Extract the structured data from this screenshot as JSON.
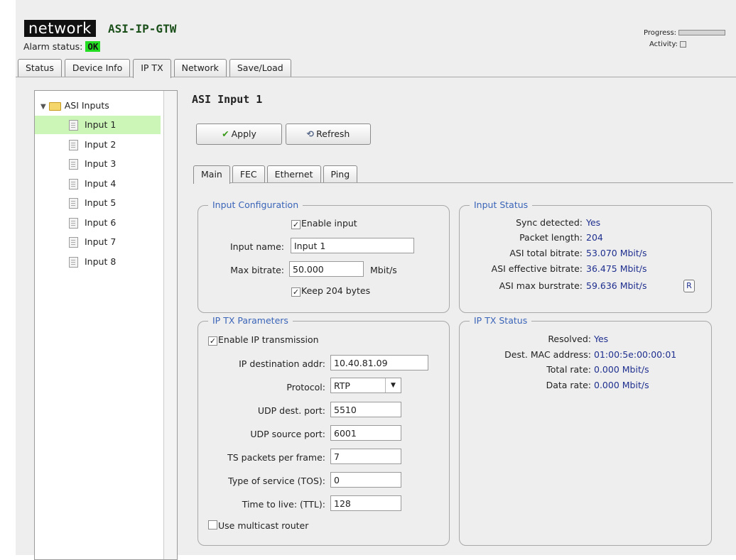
{
  "header": {
    "logo": "network",
    "device_name": "ASI-IP-GTW",
    "alarm_label": "Alarm status:",
    "alarm_value": "OK",
    "progress_label": "Progress:",
    "activity_label": "Activity:",
    "colors": {
      "ok": "#22dd22",
      "accent": "#3a64b8",
      "value": "#1f2f8f"
    }
  },
  "tabs": [
    {
      "label": "Status"
    },
    {
      "label": "Device Info"
    },
    {
      "label": "IP TX"
    },
    {
      "label": "Network"
    },
    {
      "label": "Save/Load"
    }
  ],
  "tree": {
    "root": "ASI Inputs",
    "items": [
      "Input 1",
      "Input 2",
      "Input 3",
      "Input 4",
      "Input 5",
      "Input 6",
      "Input 7",
      "Input 8"
    ]
  },
  "panel": {
    "title": "ASI Input 1",
    "apply_label": "Apply",
    "refresh_label": "Refresh",
    "subtabs": [
      "Main",
      "FEC",
      "Ethernet",
      "Ping"
    ]
  },
  "input_config": {
    "legend": "Input Configuration",
    "enable_input": "Enable input",
    "name_label": "Input name:",
    "name_value": "Input 1",
    "bitrate_label": "Max bitrate:",
    "bitrate_value": "50.000",
    "bitrate_unit": "Mbit/s",
    "keep204": "Keep 204 bytes"
  },
  "input_status": {
    "legend": "Input Status",
    "rows": [
      {
        "label": "Sync detected:",
        "value": "Yes"
      },
      {
        "label": "Packet length:",
        "value": "204"
      },
      {
        "label": "ASI total bitrate:",
        "value": "53.070 Mbit/s"
      },
      {
        "label": "ASI effective bitrate:",
        "value": "36.475 Mbit/s"
      },
      {
        "label": "ASI max burstrate:",
        "value": "59.636 Mbit/s"
      }
    ],
    "reset_label": "R"
  },
  "ip_tx_params": {
    "legend": "IP TX Parameters",
    "enable_ip": "Enable IP transmission",
    "dest_label": "IP destination addr:",
    "dest_value": "10.40.81.09",
    "protocol_label": "Protocol:",
    "protocol_value": "RTP",
    "udp_dest_label": "UDP dest. port:",
    "udp_dest_value": "5510",
    "udp_src_label": "UDP source port:",
    "udp_src_value": "6001",
    "ts_label": "TS packets per frame:",
    "ts_value": "7",
    "tos_label": "Type of service (TOS):",
    "tos_value": "0",
    "ttl_label": "Time to live: (TTL):",
    "ttl_value": "128",
    "multicast": "Use multicast router"
  },
  "ip_tx_status": {
    "legend": "IP TX Status",
    "rows": [
      {
        "label": "Resolved:",
        "value": "Yes"
      },
      {
        "label": "Dest. MAC address:",
        "value": "01:00:5e:00:00:01"
      },
      {
        "label": "Total rate:",
        "value": "0.000 Mbit/s"
      },
      {
        "label": "Data rate:",
        "value": "0.000 Mbit/s"
      }
    ]
  }
}
